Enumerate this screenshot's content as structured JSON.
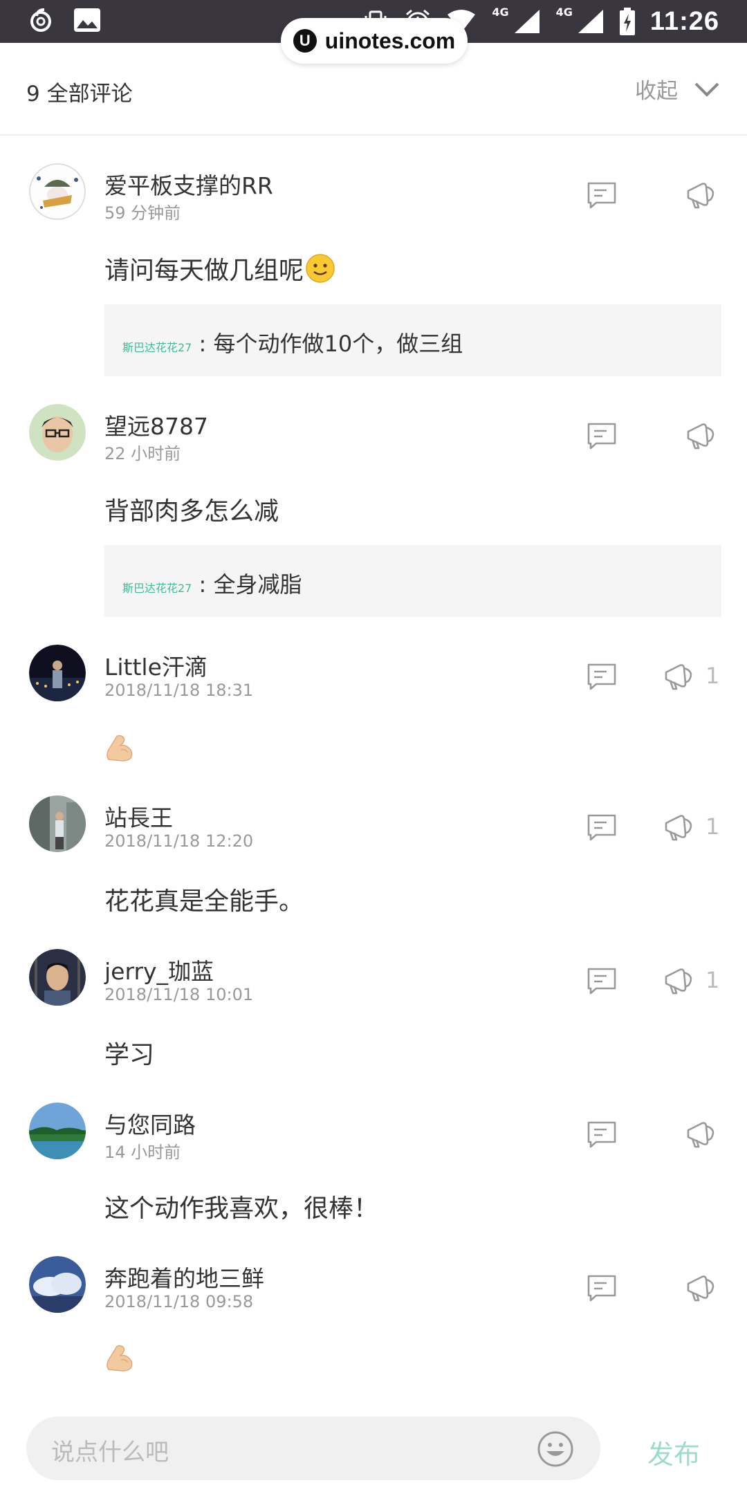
{
  "status_bar": {
    "time": "11:26",
    "network_1": "4G",
    "network_2": "4G"
  },
  "watermark": {
    "text": "uinotes.com",
    "logo": "U"
  },
  "header": {
    "title": "9 全部评论",
    "collapse_label": "收起"
  },
  "comments": [
    {
      "username": "爱平板支撑的RR",
      "time": "59 分钟前",
      "text": "请问每天做几组呢",
      "emoji": "slightly-smiling-face",
      "like_count": "",
      "reply": {
        "author": "斯巴达花花27",
        "separator": " : ",
        "text": "每个动作做10个，做三组"
      }
    },
    {
      "username": "望远8787",
      "time": "22 小时前",
      "text": "背部肉多怎么减",
      "like_count": "",
      "reply": {
        "author": "斯巴达花花27",
        "separator": " : ",
        "text": "全身减脂"
      }
    },
    {
      "username": "Little汗滴",
      "time": "2018/11/18 18:31",
      "text": "",
      "emoji": "flexed-biceps",
      "like_count": "1"
    },
    {
      "username": "站長王",
      "time": "2018/11/18 12:20",
      "text": "花花真是全能手。",
      "like_count": "1"
    },
    {
      "username": "jerry_珈蓝",
      "time": "2018/11/18 10:01",
      "text": "学习",
      "like_count": "1"
    },
    {
      "username": "与您同路",
      "time": "14 小时前",
      "text": "这个动作我喜欢，很棒！",
      "like_count": ""
    },
    {
      "username": "奔跑着的地三鲜",
      "time": "2018/11/18 09:58",
      "text": "",
      "emoji": "flexed-biceps",
      "like_count": ""
    }
  ],
  "input": {
    "placeholder": "说点什么吧",
    "publish_label": "发布"
  },
  "colors": {
    "accent_green": "#3cbf8f",
    "publish_disabled": "#9ddcc5",
    "status_bar_bg": "#3a3640"
  }
}
